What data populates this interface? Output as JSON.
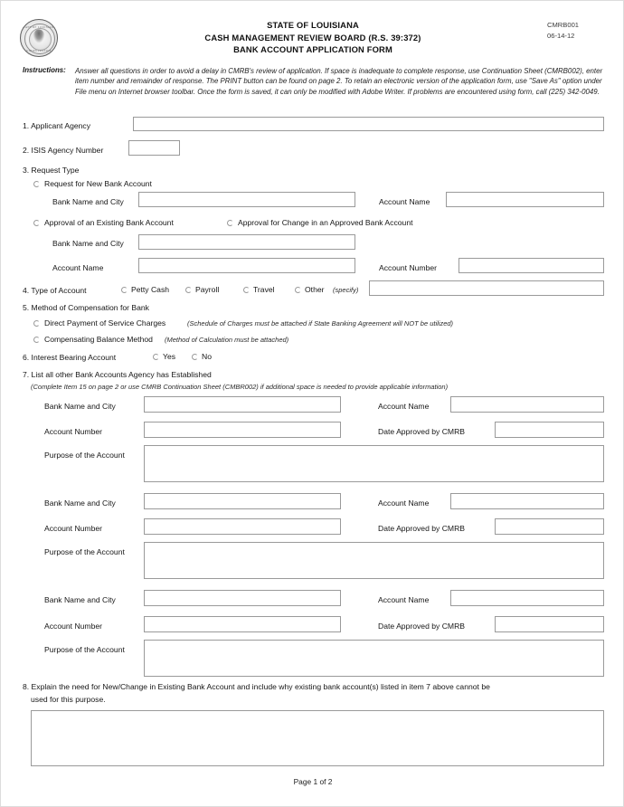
{
  "header": {
    "seal_alt": "state-of-louisiana-seal",
    "seal_text_top": "STATE OF LOUISIANA",
    "seal_text_bottom": "UNION JUSTICE",
    "title_lines": [
      "STATE OF LOUISIANA",
      "CASH MANAGEMENT REVIEW BOARD (R.S. 39:372)",
      "BANK ACCOUNT APPLICATION FORM"
    ],
    "form_code": "CMRB001",
    "form_date": "06-14-12"
  },
  "instructions": {
    "label": "Instructions:",
    "text": "Answer all questions in order to avoid a delay in CMRB's review of application.  If space is inadequate to complete response, use Continuation Sheet (CMRB002), enter item number and remainder of response.  The PRINT button can be found on page 2.  To retain an electronic version of the application form, use \"Save As\" option under File menu on  Internet browser toolbar.  Once the form is saved, it can only be  modified with Adobe Writer.  If problems are encountered using form, call (225) 342-0049."
  },
  "item1": {
    "label": "1. Applicant Agency",
    "value": "",
    "placeholder": ""
  },
  "item2": {
    "label": "2. ISIS Agency Number",
    "value": "",
    "placeholder": ""
  },
  "item3": {
    "label": "3. Request Type",
    "option_new": "Request for New Bank Account",
    "option_existing": "Approval of an Existing Bank Account",
    "option_change": "Approval for Change in an Approved Bank Account",
    "new_bank_label": "Bank Name and City",
    "new_bank_value": "",
    "new_account_name_label": "Account Name",
    "new_account_name_value": "",
    "exist_bank_label": "Bank Name and City",
    "exist_bank_value": "",
    "exist_account_name_label": "Account Name",
    "exist_account_name_value": "",
    "exist_account_number_label": "Account Number",
    "exist_account_number_value": ""
  },
  "item4": {
    "label": "4. Type of Account",
    "options": [
      "Petty Cash",
      "Payroll",
      "Travel",
      "Other"
    ],
    "other_note": "(specify)",
    "other_value": ""
  },
  "item5": {
    "label": "5. Method of Compensation for Bank",
    "option1": "Direct Payment of Service Charges",
    "option1_note": "(Schedule of Charges must be attached if State Banking Agreement will NOT be utilized)",
    "option2": "Compensating Balance Method",
    "option2_note": "(Method of Calculation must be attached)"
  },
  "item6": {
    "label": "6. Interest Bearing Account",
    "options": [
      "Yes",
      "No"
    ]
  },
  "item7": {
    "label": "7. List all other Bank Accounts Agency has Established",
    "note": "(Complete Item 15 on page 2 or use CMRB Continuation Sheet (CMBR002) if additional space is needed to provide applicable information)",
    "field_labels": {
      "bank": "Bank Name and City",
      "account_name": "Account Name",
      "account_number": "Account Number",
      "date_approved": "Date Approved by CMRB",
      "purpose": "Purpose of the Account"
    },
    "entries": [
      {
        "bank": "",
        "account_name": "",
        "account_number": "",
        "date_approved": "",
        "purpose": ""
      },
      {
        "bank": "",
        "account_name": "",
        "account_number": "",
        "date_approved": "",
        "purpose": ""
      },
      {
        "bank": "",
        "account_name": "",
        "account_number": "",
        "date_approved": "",
        "purpose": ""
      }
    ]
  },
  "item8": {
    "label_line1": "8. Explain the need for New/Change in Existing Bank Account and include why existing bank account(s) listed in item 7 above cannot be",
    "label_line2": "used for this purpose.",
    "value": ""
  },
  "footer": {
    "page_label": "Page 1 of 2"
  }
}
